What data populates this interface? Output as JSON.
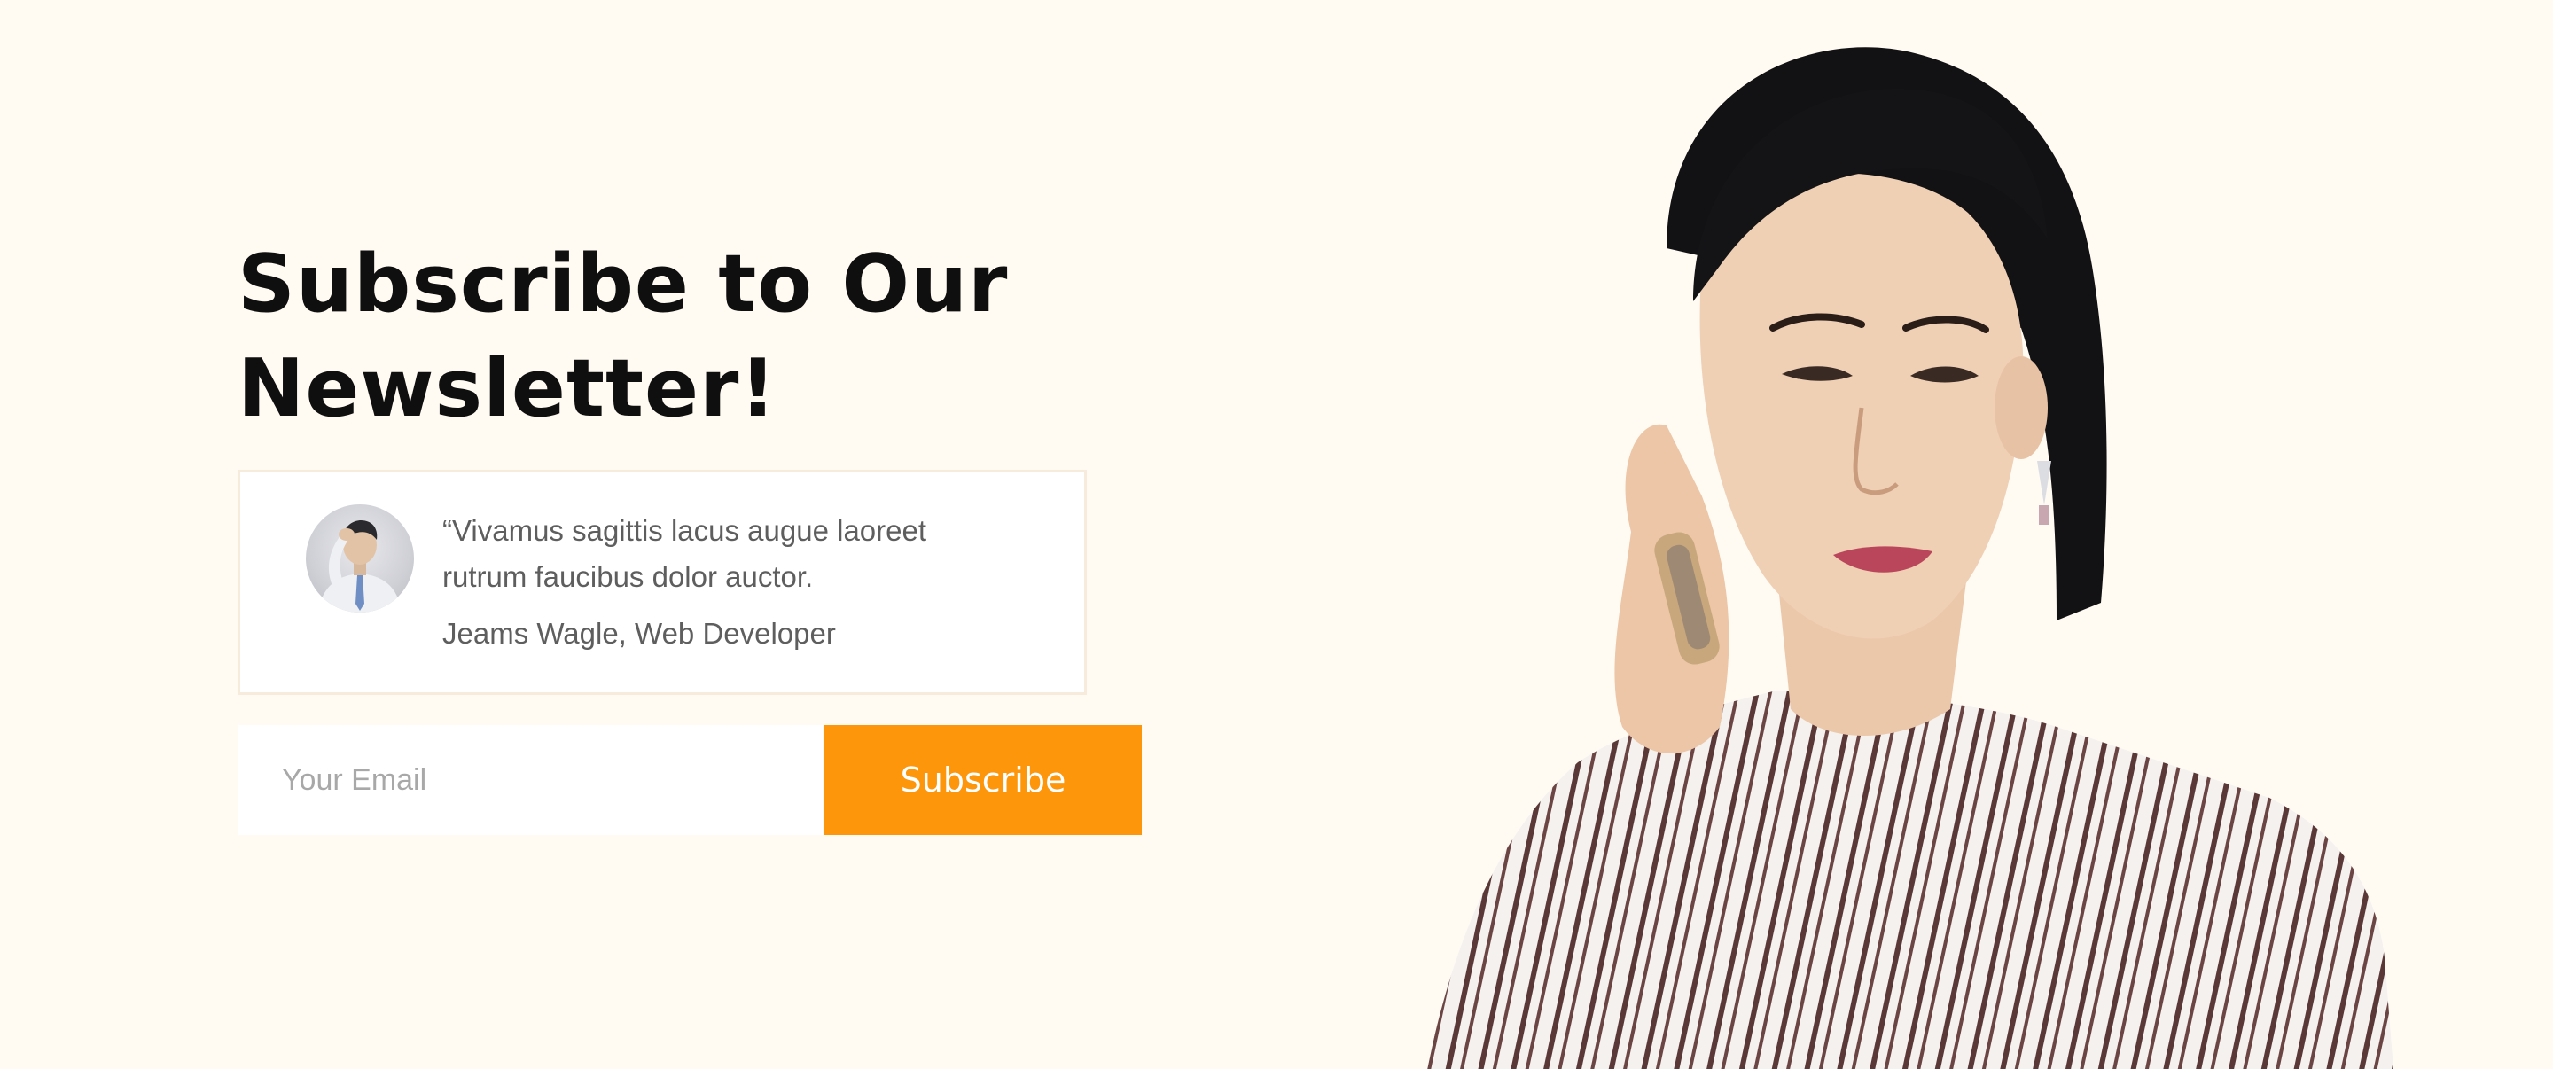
{
  "newsletter": {
    "heading_line1": "Subscribe to Our",
    "heading_line2": "Newsletter!",
    "testimonial": {
      "quote_line1": "“Vivamus sagittis lacus  augue laoreet",
      "quote_line2": "rutrum faucibus dolor auctor.",
      "author": "Jeams Wagle, Web Developer"
    },
    "form": {
      "email_placeholder": "Your Email",
      "email_value": "",
      "button_label": "Subscribe"
    }
  },
  "colors": {
    "background": "#fffbf3",
    "accent": "#fd960a",
    "heading": "#0f0f0f",
    "body_text": "#5e5e5e",
    "card_border": "#f7ecdc"
  }
}
